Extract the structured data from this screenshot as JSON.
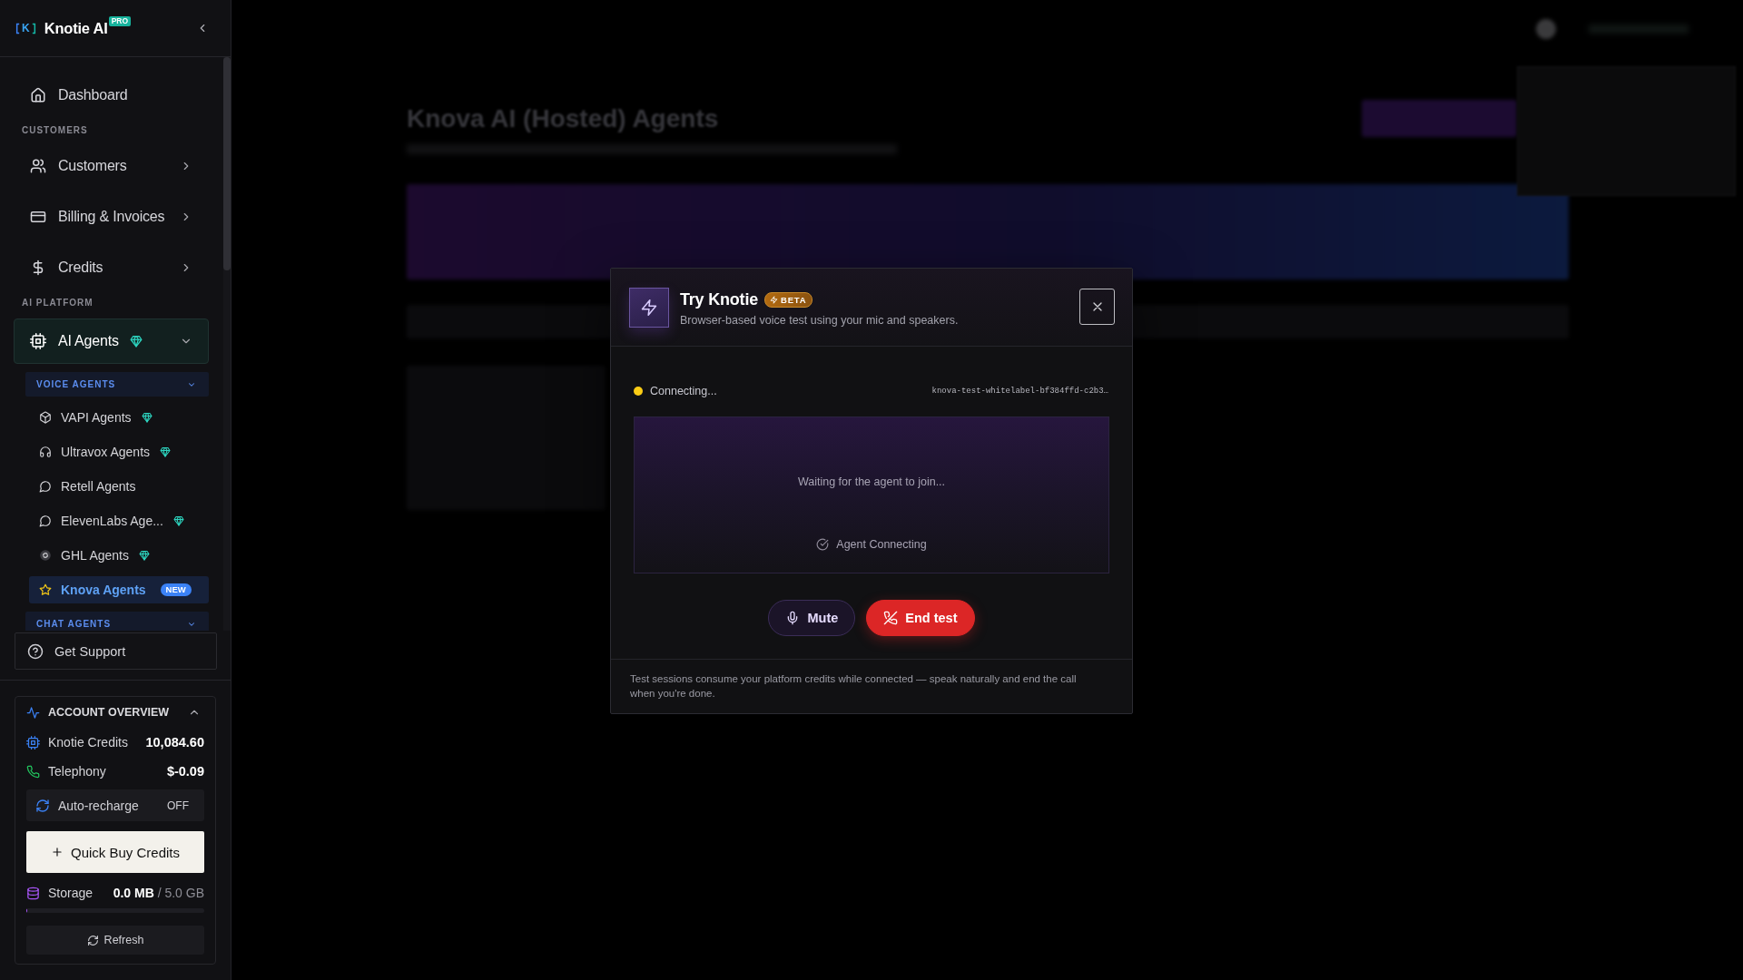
{
  "sidebar": {
    "brand": {
      "logo": "K",
      "name": "Knotie AI",
      "badge": "PRO"
    },
    "home": {
      "label": "Dashboard"
    },
    "sections": [
      {
        "title": "CUSTOMERS",
        "items": [
          {
            "label": "Customers",
            "selected": false,
            "premium": false,
            "expanded": false
          },
          {
            "label": "Billing & Invoices",
            "selected": false,
            "premium": false,
            "expanded": false
          },
          {
            "label": "Credits",
            "selected": false,
            "premium": false,
            "expanded": false
          }
        ]
      },
      {
        "title": "AI PLATFORM",
        "items": [
          {
            "label": "AI Agents",
            "selected": true,
            "premium": true,
            "expanded": true,
            "groups": [
              {
                "title": "VOICE AGENTS",
                "items": [
                  {
                    "label": "VAPI Agents",
                    "premium": true,
                    "selected": false
                  },
                  {
                    "label": "Ultravox Agents",
                    "premium": true,
                    "selected": false
                  },
                  {
                    "label": "Retell Agents",
                    "premium": false,
                    "selected": false
                  },
                  {
                    "label": "ElevenLabs Age...",
                    "premium": true,
                    "selected": false
                  },
                  {
                    "label": "GHL Agents",
                    "premium": true,
                    "selected": false
                  },
                  {
                    "label": "Knova Agents",
                    "premium": false,
                    "selected": true,
                    "badge": "NEW"
                  }
                ]
              },
              {
                "title": "CHAT AGENTS"
              }
            ]
          }
        ]
      }
    ],
    "support": {
      "label": "Get Support"
    },
    "account": {
      "title": "ACCOUNT OVERVIEW",
      "expanded": true,
      "rows": [
        {
          "label": "Knotie Credits",
          "value": "10,084.60"
        },
        {
          "label": "Telephony",
          "value": "$-0.09"
        }
      ],
      "auto_recharge": {
        "label": "Auto-recharge",
        "value": "OFF"
      },
      "buy_button": "Quick Buy Credits",
      "storage": {
        "label": "Storage",
        "usage": "**0.0 MB** / 5.0 GB",
        "level": 0
      },
      "refresh_button": "Refresh"
    }
  },
  "background": {
    "title": "Knova AI (Hosted) Agents"
  },
  "dialog": {
    "title": "Try Knotie",
    "badge": "BETA",
    "subtitle": "Browser-based voice test using your mic and speakers.",
    "status": "Connecting...",
    "session_id": "knova-test-whitelabel-bf384ffd-c2b3…",
    "stage": {
      "message": "Waiting for the agent to join...",
      "agent_status": "Agent Connecting"
    },
    "buttons": [
      {
        "kind": "mute",
        "label": "Mute"
      },
      {
        "kind": "end",
        "label": "End test"
      }
    ],
    "footer": "Test sessions consume your platform credits while connected — speak naturally and end the call when you're done."
  }
}
